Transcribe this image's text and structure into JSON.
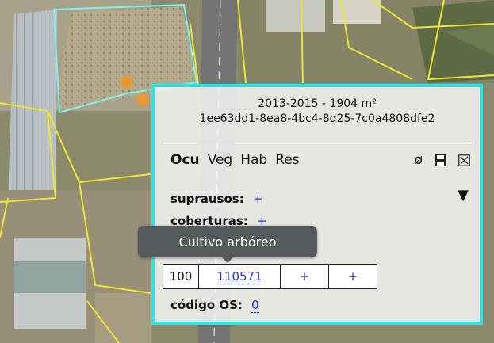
{
  "popup": {
    "title": "2013-2015 - 1904 m²",
    "id": "1ee63dd1-8ea8-4bc4-8d25-7c0a4808dfe2",
    "tabs": [
      {
        "label": "Ocu",
        "active": true
      },
      {
        "label": "Veg",
        "active": false
      },
      {
        "label": "Hab",
        "active": false
      },
      {
        "label": "Res",
        "active": false
      }
    ],
    "actions": {
      "clear_symbol": "ø",
      "save_icon": "floppy-disk-icon",
      "close_icon": "close-box-icon"
    },
    "supra_label": "suprausos:",
    "cob_label": "coberturas:",
    "add_symbol": "+",
    "expand_symbol": "▼",
    "table_row": [
      "100",
      "110571",
      "+",
      "+"
    ],
    "codigo_label": "código OS:",
    "codigo_value": "0"
  },
  "tooltip": {
    "text": "Cultivo arbóreo"
  },
  "colors": {
    "accent": "#2ee3e8",
    "link": "#2233dd",
    "parcel_outline": "#f0e632",
    "tooltip_bg": "#555a5c"
  }
}
